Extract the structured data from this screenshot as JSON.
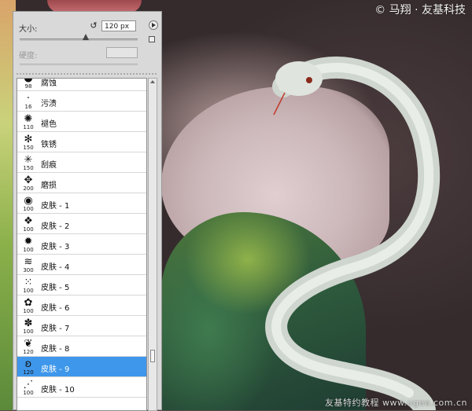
{
  "watermark": {
    "top": "© 马翔 · 友基科技",
    "bottom": "友基特约教程 www.ugee.com.cn"
  },
  "brush_panel": {
    "size_label": "大小:",
    "size_value": "120 px",
    "size_slider_fraction": 0.56,
    "hardness_label": "硬度:",
    "hardness_value": "",
    "presets": [
      {
        "size": "98",
        "name": "腐蚀"
      },
      {
        "size": "16",
        "name": "污渍"
      },
      {
        "size": "110",
        "name": "褪色"
      },
      {
        "size": "150",
        "name": "铁锈"
      },
      {
        "size": "150",
        "name": "刮痕"
      },
      {
        "size": "200",
        "name": "磨损"
      },
      {
        "size": "100",
        "name": "皮肤 - 1"
      },
      {
        "size": "100",
        "name": "皮肤 - 2"
      },
      {
        "size": "100",
        "name": "皮肤 - 3"
      },
      {
        "size": "300",
        "name": "皮肤 - 4"
      },
      {
        "size": "100",
        "name": "皮肤 - 5"
      },
      {
        "size": "100",
        "name": "皮肤 - 6"
      },
      {
        "size": "100",
        "name": "皮肤 - 7"
      },
      {
        "size": "120",
        "name": "皮肤 - 8"
      },
      {
        "size": "120",
        "name": "皮肤 - 9"
      },
      {
        "size": "100",
        "name": "皮肤 - 10"
      }
    ],
    "selected_index": 14,
    "colors": {
      "selection": "#3e97ea",
      "panel": "#d9d9d9"
    }
  }
}
